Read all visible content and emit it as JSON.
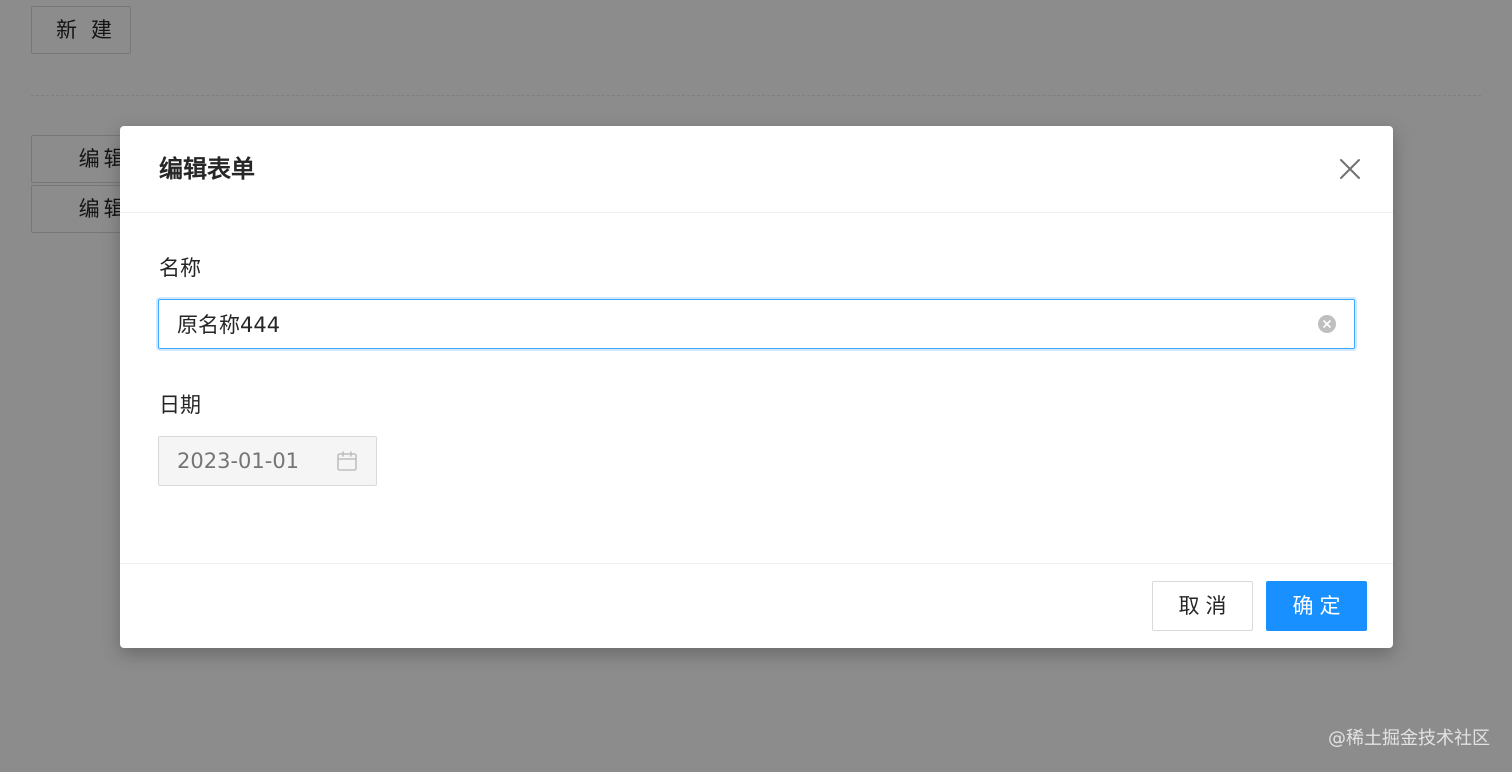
{
  "background": {
    "new_button": "新 建",
    "edit_buttons": [
      "编辑 原",
      "编辑 另"
    ]
  },
  "modal": {
    "title": "编辑表单",
    "close_icon": "close-icon",
    "fields": {
      "name": {
        "label": "名称",
        "value": "原名称444",
        "clear_icon": "close-circle-icon"
      },
      "date": {
        "label": "日期",
        "placeholder": "2023-01-01",
        "icon": "calendar-icon",
        "disabled": true
      }
    },
    "footer": {
      "cancel_label": "取消",
      "ok_label": "确定"
    }
  },
  "colors": {
    "primary": "#1890ff",
    "focus_border": "#40a9ff",
    "mask": "rgba(0,0,0,0.45)",
    "disabled_bg": "#f5f5f5",
    "text": "#262626",
    "placeholder": "#bfbfbf"
  },
  "watermark": "@稀土掘金技术社区"
}
